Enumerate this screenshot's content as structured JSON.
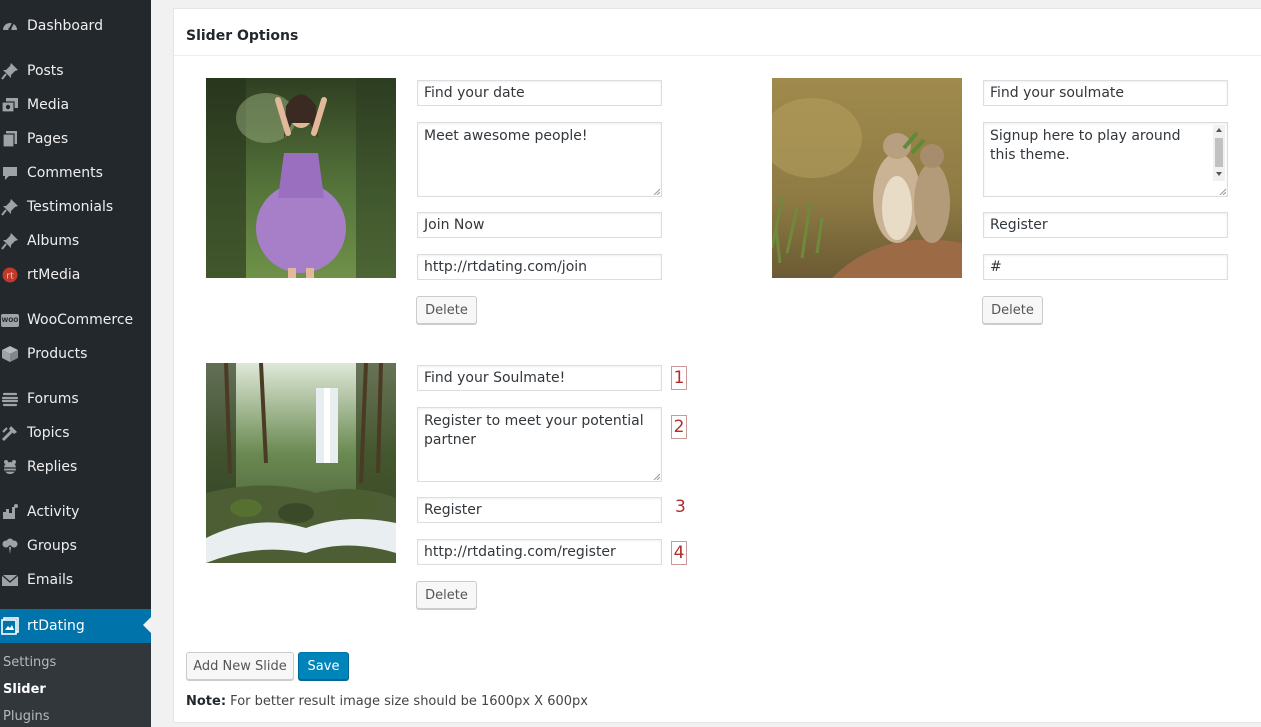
{
  "sidebar": {
    "items": [
      {
        "label": "Dashboard",
        "icon": "dashboard-icon"
      },
      {
        "label": "Posts",
        "icon": "pin-icon"
      },
      {
        "label": "Media",
        "icon": "media-icon"
      },
      {
        "label": "Pages",
        "icon": "pages-icon"
      },
      {
        "label": "Comments",
        "icon": "comment-icon"
      },
      {
        "label": "Testimonials",
        "icon": "pin-icon"
      },
      {
        "label": "Albums",
        "icon": "pin-icon"
      },
      {
        "label": "rtMedia",
        "icon": "rtmedia-icon"
      },
      {
        "label": "WooCommerce",
        "icon": "woocommerce-icon"
      },
      {
        "label": "Products",
        "icon": "cube-icon"
      },
      {
        "label": "Forums",
        "icon": "forums-icon"
      },
      {
        "label": "Topics",
        "icon": "topics-icon"
      },
      {
        "label": "Replies",
        "icon": "replies-icon"
      },
      {
        "label": "Activity",
        "icon": "activity-icon"
      },
      {
        "label": "Groups",
        "icon": "groups-icon"
      },
      {
        "label": "Emails",
        "icon": "envelope-icon"
      },
      {
        "label": "rtDating",
        "icon": "rtdating-icon",
        "current": true
      }
    ],
    "woo_badge": "WOO",
    "submenu": [
      {
        "label": "Settings"
      },
      {
        "label": "Slider",
        "active": true
      },
      {
        "label": "Plugins"
      }
    ]
  },
  "panel": {
    "title": "Slider Options",
    "slides": [
      {
        "title": "Find your date",
        "description": "Meet awesome people!",
        "button_text": "Join Now",
        "button_link": "http://rtdating.com/join",
        "delete_label": "Delete",
        "image": "woman-in-purple-dress-forest"
      },
      {
        "title": "Find your soulmate",
        "description": "Signup here to play around this theme.",
        "button_text": "Register",
        "button_link": "#",
        "delete_label": "Delete",
        "image": "prairie-dogs-eating"
      },
      {
        "title": "Find your Soulmate!",
        "description": "Register to meet your potential partner",
        "button_text": "Register",
        "button_link": "http://rtdating.com/register",
        "delete_label": "Delete",
        "image": "forest-waterfall-stream"
      }
    ],
    "annotations": [
      "1",
      "2",
      "3",
      "4"
    ],
    "add_slide_label": "Add New Slide",
    "save_label": "Save",
    "note_label": "Note:",
    "note_text": " For better result image size should be 1600px X 600px"
  },
  "colors": {
    "sidebar_bg": "#23282d",
    "active_menu": "#0073aa",
    "primary_button": "#0085ba",
    "annotation_red": "#b32d2e"
  }
}
